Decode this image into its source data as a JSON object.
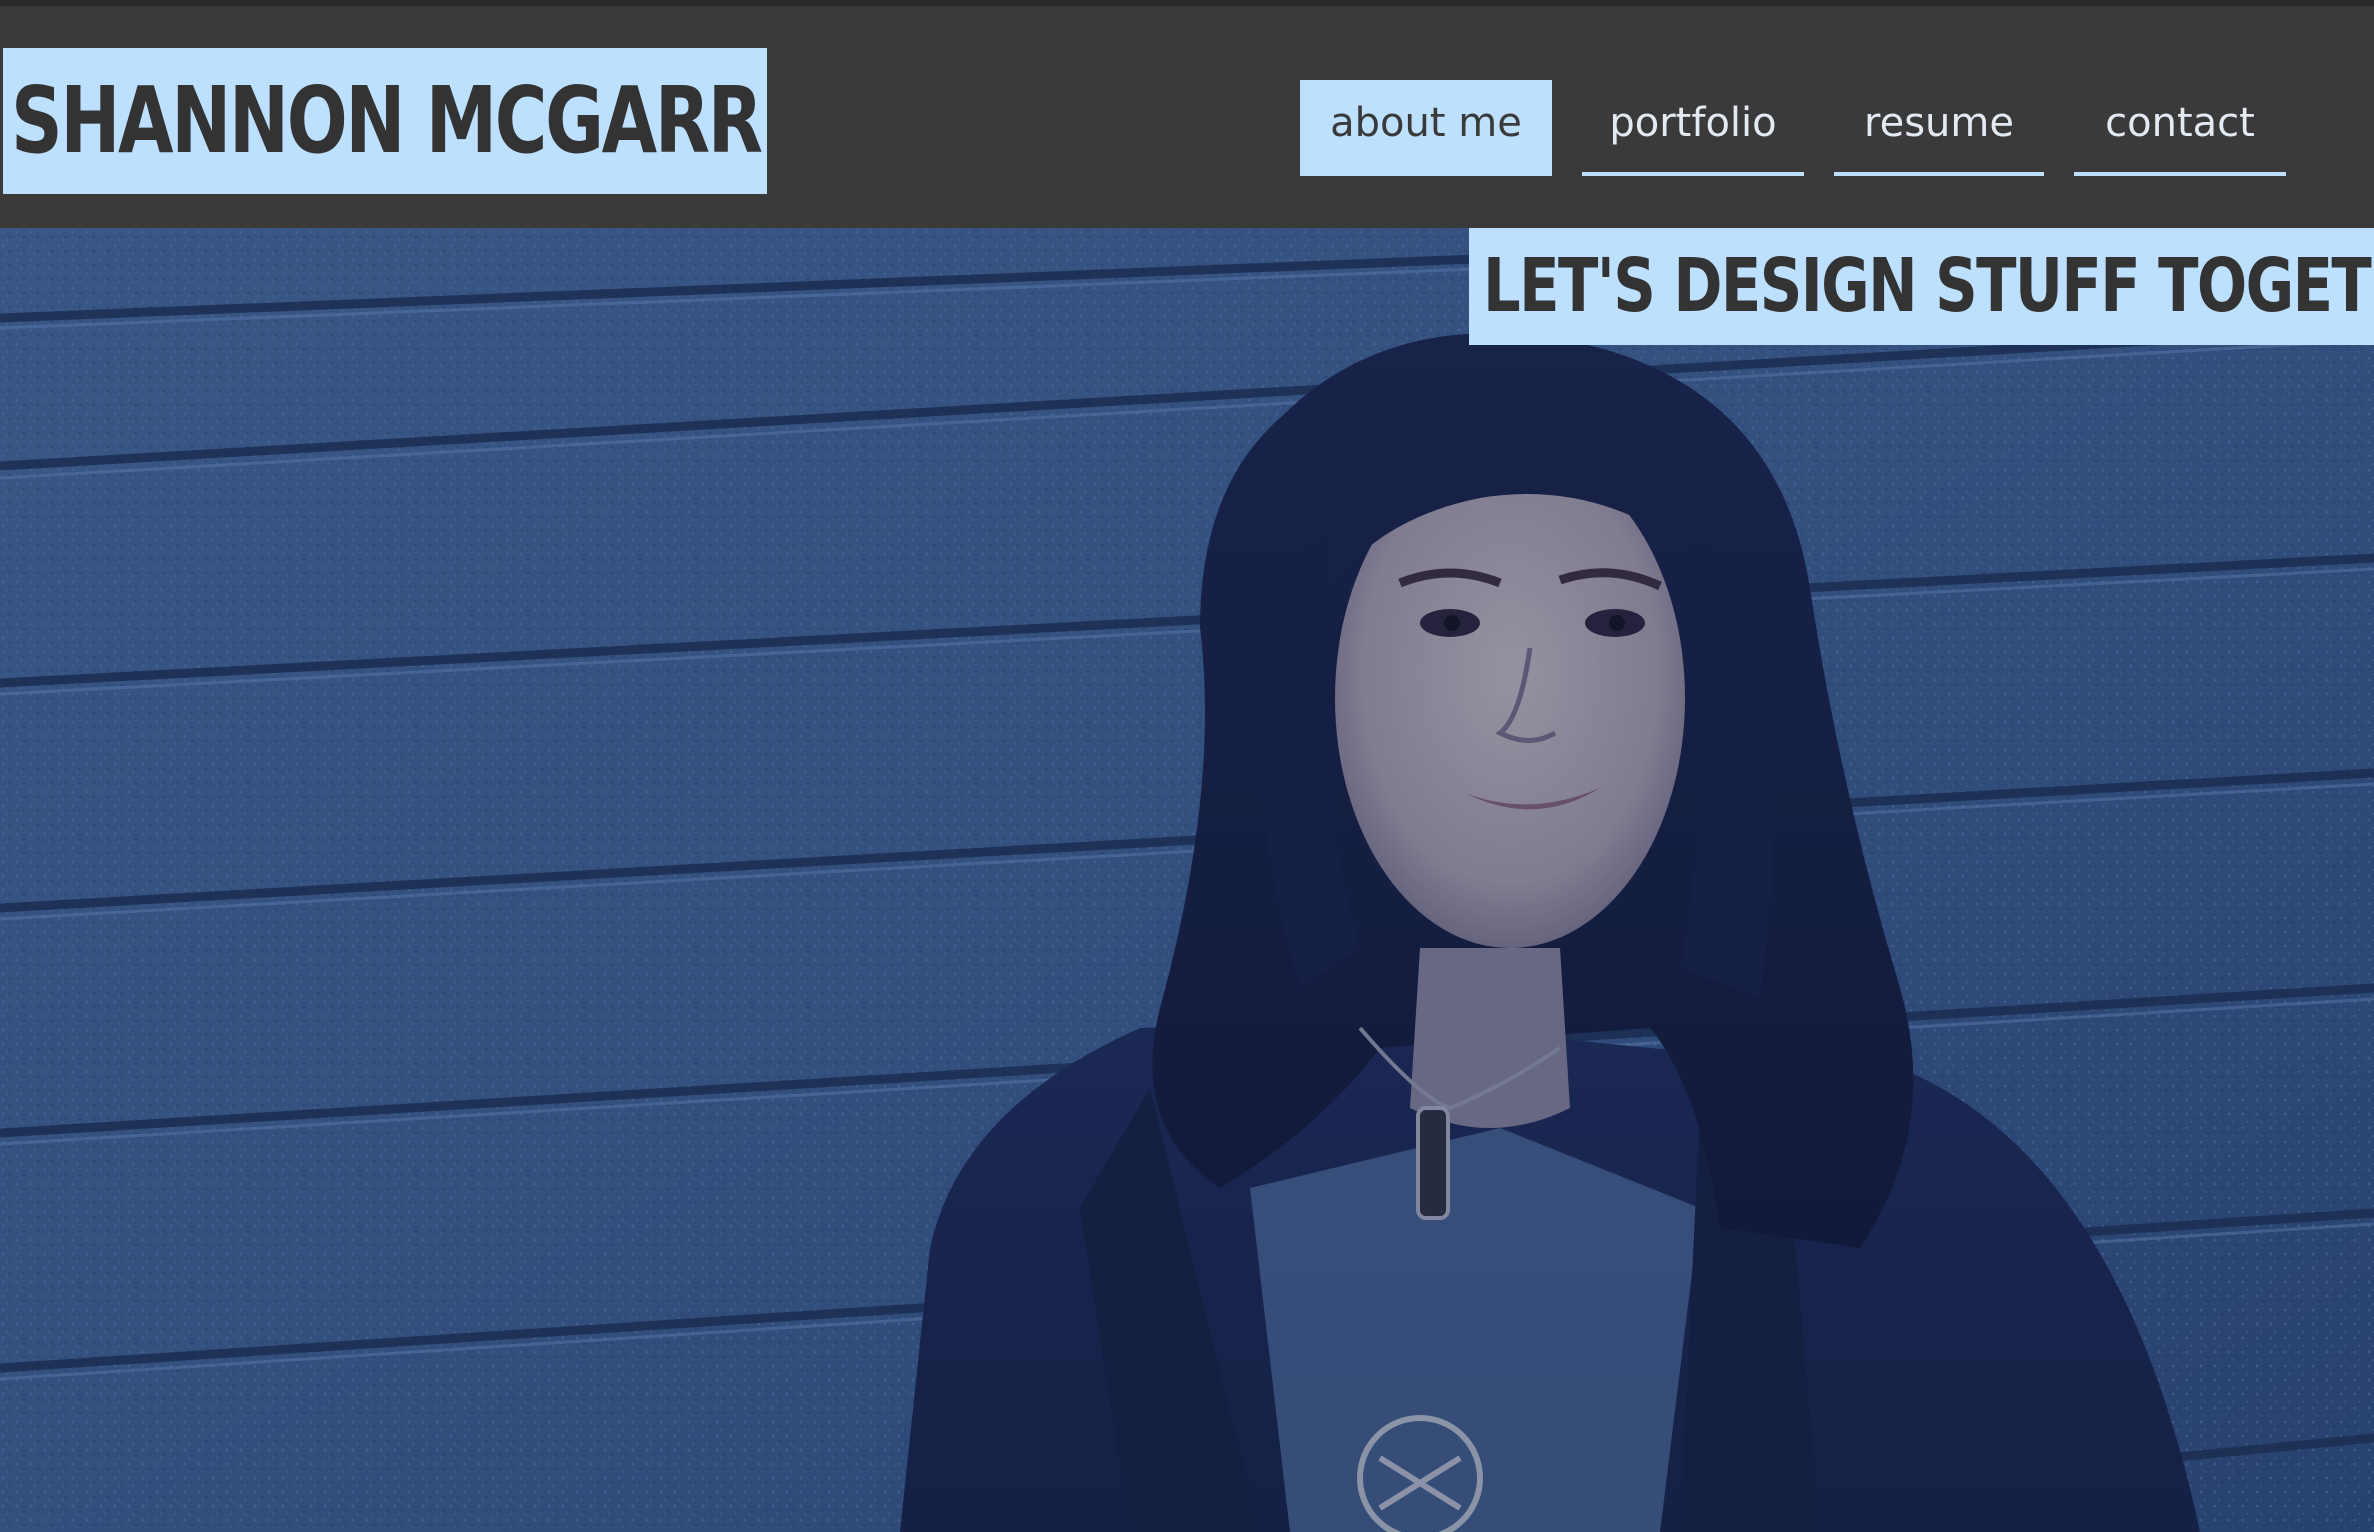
{
  "header": {
    "logo_text": "SHANNON MCGARR"
  },
  "nav": {
    "items": [
      {
        "label": "about me",
        "active": true
      },
      {
        "label": "portfolio",
        "active": false
      },
      {
        "label": "resume",
        "active": false
      },
      {
        "label": "contact",
        "active": false
      }
    ]
  },
  "hero": {
    "tagline": "LET'S DESIGN STUFF TOGETHER!"
  },
  "colors": {
    "background": "#3a3a3a",
    "accent": "#bde0ff",
    "text_dark": "#333333",
    "nav_text": "#e4eaf2",
    "photo_wall": "#3f5f92"
  }
}
